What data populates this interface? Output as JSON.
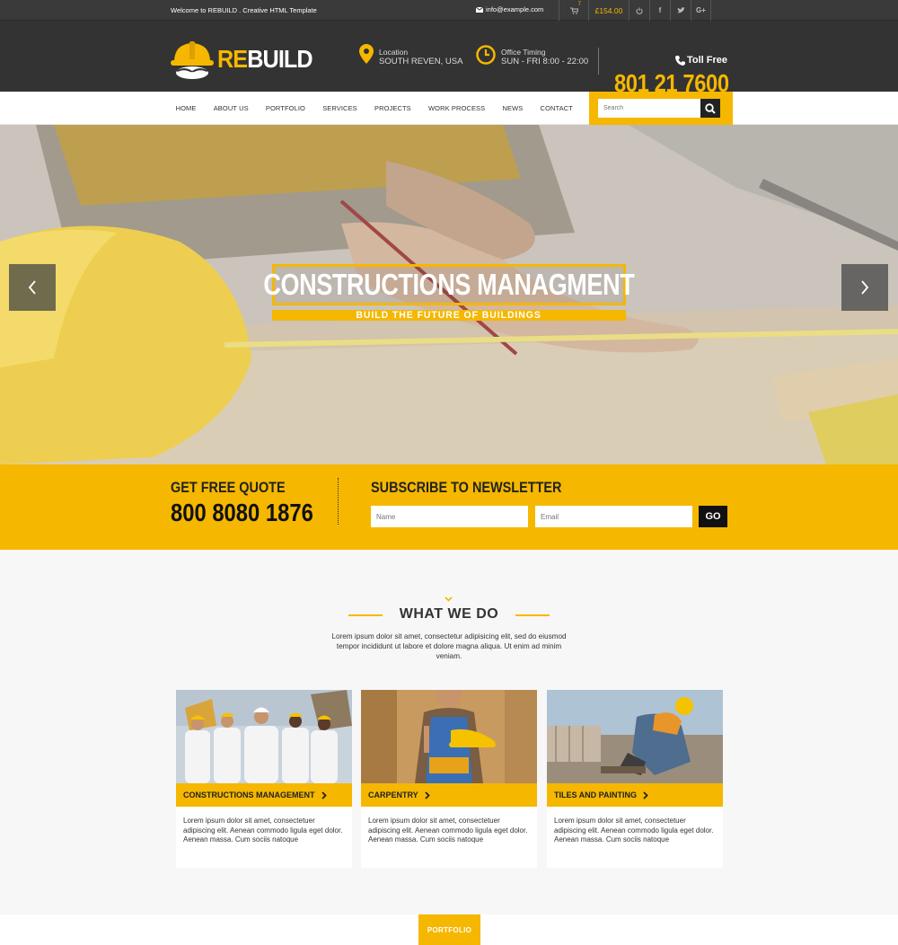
{
  "topbar": {
    "welcome": "Welcome to REBUILD . Creative HTML Template",
    "email": "info@example.com",
    "cart_count": "7",
    "cart_total": "£154.00",
    "icons": [
      "cart-icon",
      "power-icon",
      "facebook-icon",
      "twitter-icon",
      "google-plus-icon"
    ]
  },
  "header": {
    "logo_re": "RE",
    "logo_build": "BUILD",
    "location_label": "Location",
    "location_value": "SOUTH REVEN, USA",
    "timing_label": "Office Timing",
    "timing_value": "SUN - FRI 8:00 - 22:00",
    "toll_free": "Toll Free",
    "phone": "801 21 7600"
  },
  "nav": {
    "items": [
      "HOME",
      "ABOUT US",
      "PORTFOLIO",
      "SERVICES",
      "PROJECTS",
      "WORK PROCESS",
      "NEWS",
      "CONTACT"
    ],
    "search_placeholder": "Search"
  },
  "hero": {
    "title": "CONSTRUCTIONS MANAGMENT",
    "subtitle": "BUILD THE FUTURE OF BUILDINGS"
  },
  "quote": {
    "heading": "GET FREE QUOTE",
    "number": "800 8080 1876"
  },
  "newsletter": {
    "heading": "SUBSCRIBE TO NEWSLETTER",
    "name_placeholder": "Name",
    "email_placeholder": "Email",
    "button": "GO"
  },
  "what_we_do": {
    "title": "WHAT WE DO",
    "description": "Lorem ipsum dolor sit amet, consectetur adipisicing elit, sed do eiusmod tempor incididunt ut labore et dolore magna aliqua. Ut enim ad minim veniam.",
    "cards": [
      {
        "title": "CONSTRUCTIONS MANAGEMENT",
        "text": "Lorem ipsum dolor sit amet, consectetuer adipiscing elit. Aenean commodo ligula eget dolor. Aenean massa. Cum sociis natoque"
      },
      {
        "title": "CARPENTRY",
        "text": "Lorem ipsum dolor sit amet, consectetuer adipiscing elit. Aenean commodo ligula eget dolor. Aenean massa. Cum sociis natoque"
      },
      {
        "title": "TILES AND PAINTING",
        "text": "Lorem ipsum dolor sit amet, consectetuer adipiscing elit. Aenean commodo ligula eget dolor. Aenean massa. Cum sociis natoque"
      }
    ]
  },
  "portfolio": {
    "tab": "PORTFOLIO"
  },
  "colors": {
    "accent": "#f5b700",
    "dark": "#333333"
  }
}
